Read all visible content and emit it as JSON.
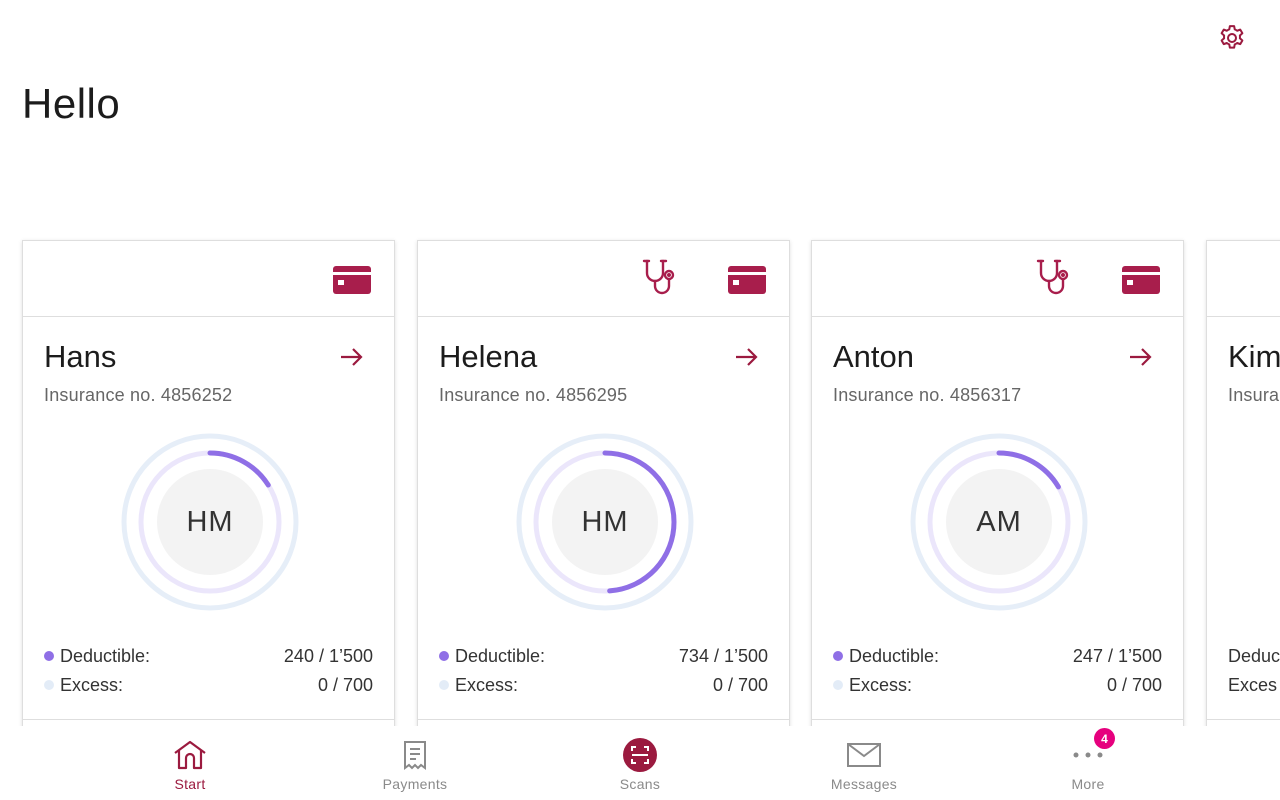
{
  "header": {
    "greeting": "Hello",
    "settings_icon": "gear-icon"
  },
  "colors": {
    "accent": "#9b1a3f",
    "card_icon": "#a81e4c",
    "deductible": "#8f6fe6",
    "excess": "#e3ecf7",
    "badge": "#e6007e"
  },
  "cards": [
    {
      "name": "Hans",
      "insurance_no": "Insurance no. 4856252",
      "initials": "HM",
      "has_doctor_icon": false,
      "deductible_label": "Deductible:",
      "deductible_value": "240 / 1’500",
      "deductible_fraction": 0.16,
      "excess_label": "Excess:",
      "excess_value": "0 / 700"
    },
    {
      "name": "Helena",
      "insurance_no": "Insurance no. 4856295",
      "initials": "HM",
      "has_doctor_icon": true,
      "deductible_label": "Deductible:",
      "deductible_value": "734 / 1’500",
      "deductible_fraction": 0.489,
      "excess_label": "Excess:",
      "excess_value": "0 / 700"
    },
    {
      "name": "Anton",
      "insurance_no": "Insurance no. 4856317",
      "initials": "AM",
      "has_doctor_icon": true,
      "deductible_label": "Deductible:",
      "deductible_value": "247 / 1’500",
      "deductible_fraction": 0.165,
      "excess_label": "Excess:",
      "excess_value": "0 / 700"
    },
    {
      "name": "Kim",
      "insurance_no": "Insura",
      "initials": "",
      "has_doctor_icon": false,
      "deductible_label": "Deduc",
      "deductible_value": "",
      "deductible_fraction": 0,
      "excess_label": "Exces",
      "excess_value": ""
    }
  ],
  "nav": {
    "items": [
      {
        "label": "Start",
        "icon": "home-icon",
        "active": true
      },
      {
        "label": "Payments",
        "icon": "receipt-icon",
        "active": false
      },
      {
        "label": "Scans",
        "icon": "scan-icon",
        "active": false
      },
      {
        "label": "Messages",
        "icon": "envelope-icon",
        "active": false
      },
      {
        "label": "More",
        "icon": "more-dots-icon",
        "active": false,
        "badge": "4"
      }
    ]
  }
}
